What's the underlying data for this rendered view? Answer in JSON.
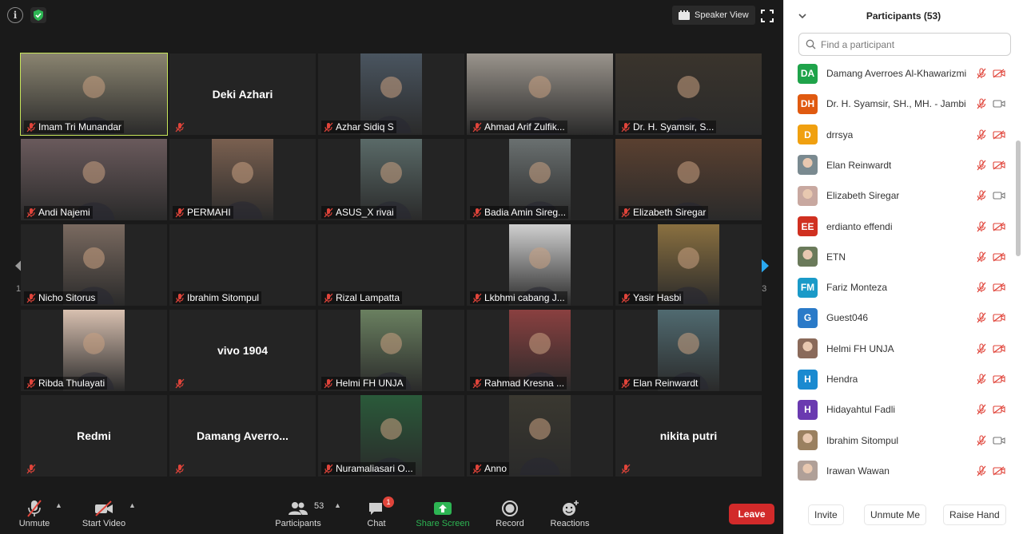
{
  "meeting": {
    "view_button_label": "Speaker View",
    "page_indicator_left": "1/3",
    "page_indicator_right": "1/3",
    "tiles": [
      {
        "name": "Imam Tri Munandar",
        "video": true,
        "active": true,
        "color": "#8a8470"
      },
      {
        "name": "Deki Azhari",
        "video": false
      },
      {
        "name": "Azhar Sidiq S",
        "video": true,
        "color": "#4a5560"
      },
      {
        "name": "Ahmad Arif Zulfik...",
        "video": true,
        "color": "#9a948c"
      },
      {
        "name": "Dr. H. Syamsir, S...",
        "video": true,
        "color": "#3a342c"
      },
      {
        "name": "Andi Najemi",
        "video": true,
        "color": "#6a5a5c"
      },
      {
        "name": "PERMAHI",
        "video": true,
        "color": "#7a6050"
      },
      {
        "name": "ASUS_X rivai",
        "video": true,
        "color": "#5a6a68"
      },
      {
        "name": "Badia Amin Sireg...",
        "video": true,
        "color": "#6a7070"
      },
      {
        "name": "Elizabeth Siregar",
        "video": true,
        "color": "#5a4030"
      },
      {
        "name": "Nicho Sitorus",
        "video": true,
        "color": "#7a6a60"
      },
      {
        "name": "Ibrahim Sitompul",
        "video": false,
        "label_only": true
      },
      {
        "name": "Rizal Lampatta",
        "video": false,
        "label_only": true
      },
      {
        "name": "Lkbhmi cabang J...",
        "video": true,
        "color": "#d0d0d0"
      },
      {
        "name": "Yasir Hasbi",
        "video": true,
        "color": "#8a7040"
      },
      {
        "name": "Ribda Thulayati",
        "video": true,
        "color": "#d8c0b0"
      },
      {
        "name": "vivo 1904",
        "video": false
      },
      {
        "name": "Helmi FH UNJA",
        "video": true,
        "color": "#6a8060"
      },
      {
        "name": "Rahmad Kresna ...",
        "video": true,
        "color": "#8a4040"
      },
      {
        "name": "Elan Reinwardt",
        "video": true,
        "color": "#506a70"
      },
      {
        "name": "Redmi",
        "video": false
      },
      {
        "name": "Damang  Averro...",
        "video": false
      },
      {
        "name": "Nuramaliasari O...",
        "video": true,
        "color": "#2a5a3a"
      },
      {
        "name": "Anno",
        "video": true,
        "color": "#3a3830"
      },
      {
        "name": "nikita putri",
        "video": false
      }
    ]
  },
  "toolbar": {
    "unmute": "Unmute",
    "start_video": "Start Video",
    "participants": "Participants",
    "participants_count": "53",
    "chat": "Chat",
    "chat_badge": "1",
    "share_screen": "Share Screen",
    "record": "Record",
    "reactions": "Reactions",
    "leave": "Leave"
  },
  "panel": {
    "title": "Participants (53)",
    "search_placeholder": "Find a participant",
    "participants": [
      {
        "initials": "DA",
        "name": "Damang Averroes Al-Khawarizmi",
        "color": "#1fa34a",
        "cam": "off"
      },
      {
        "initials": "DH",
        "name": "Dr. H. Syamsir, SH., MH. - Jambi",
        "color": "#e05a10",
        "cam": "on"
      },
      {
        "initials": "D",
        "name": "drrsya",
        "color": "#f0a010",
        "cam": "off"
      },
      {
        "initials": "",
        "name": "Elan Reinwardt",
        "color": "#7a8a90",
        "cam": "off",
        "photo": true
      },
      {
        "initials": "",
        "name": "Elizabeth Siregar",
        "color": "#c8a8a0",
        "cam": "on",
        "photo": true
      },
      {
        "initials": "EE",
        "name": "erdianto effendi",
        "color": "#d03020",
        "cam": "off"
      },
      {
        "initials": "",
        "name": "ETN",
        "color": "#6a7a5a",
        "cam": "off",
        "photo": true
      },
      {
        "initials": "FM",
        "name": "Fariz Monteza",
        "color": "#1a9ac8",
        "cam": "off"
      },
      {
        "initials": "G",
        "name": "Guest046",
        "color": "#2a7ac8",
        "cam": "off"
      },
      {
        "initials": "",
        "name": "Helmi FH UNJA",
        "color": "#8a6a5a",
        "cam": "off",
        "photo": true
      },
      {
        "initials": "H",
        "name": "Hendra",
        "color": "#1a8ad0",
        "cam": "off"
      },
      {
        "initials": "H",
        "name": "Hidayahtul Fadli",
        "color": "#6a3ab0",
        "cam": "off"
      },
      {
        "initials": "",
        "name": "Ibrahim Sitompul",
        "color": "#9a8060",
        "cam": "on",
        "photo": true
      },
      {
        "initials": "",
        "name": "Irawan Wawan",
        "color": "#b0a098",
        "cam": "off",
        "photo": true
      }
    ],
    "invite": "Invite",
    "unmute_me": "Unmute Me",
    "raise_hand": "Raise Hand"
  },
  "colors": {
    "accent_active": "#c8e65a",
    "mute_red": "#e0443a",
    "leave_red": "#d22a2a",
    "share_green": "#2db553"
  }
}
